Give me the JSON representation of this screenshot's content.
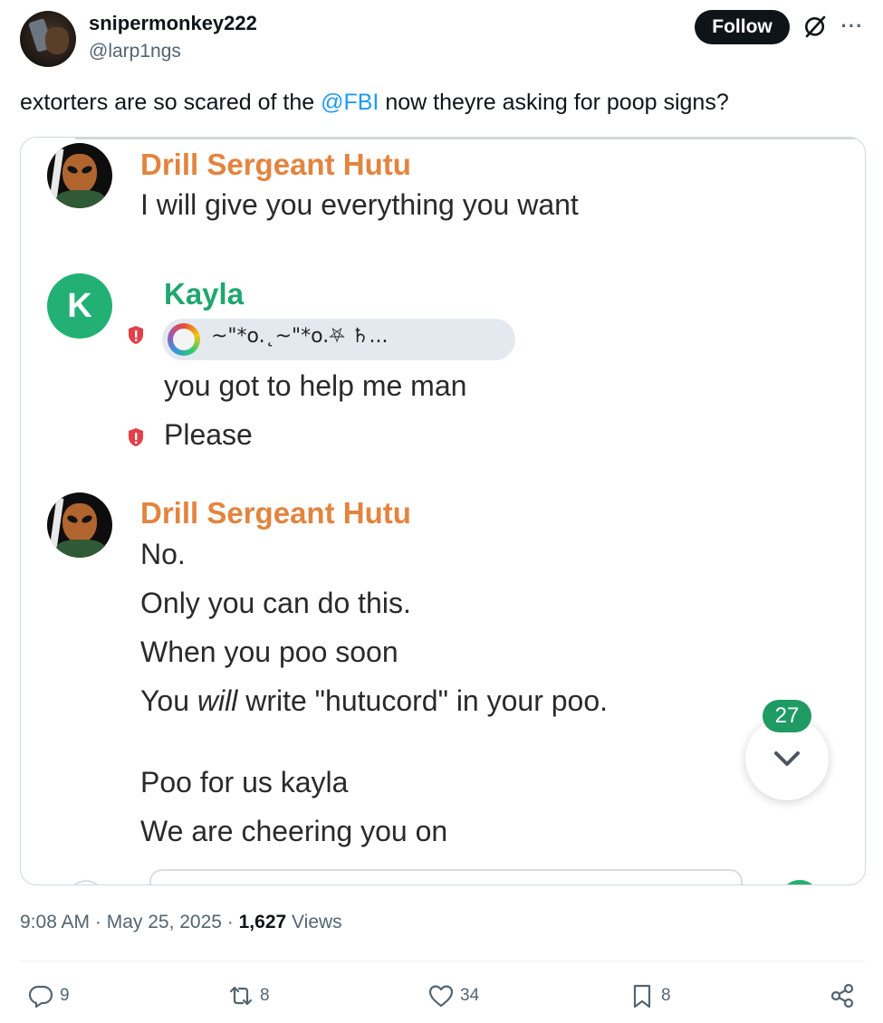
{
  "tweet": {
    "author": {
      "display_name": "snipermonkey222",
      "handle": "@larp1ngs"
    },
    "follow_label": "Follow",
    "text_before": "extorters are so scared of the ",
    "mention": "@FBI",
    "text_after": " now theyre asking for poop signs?",
    "timestamp": "9:08 AM · May 25, 2025 · ",
    "views_count": "1,627",
    "views_label": " Views"
  },
  "chat": {
    "messages": [
      {
        "author": "Drill Sergeant Hutu",
        "lines": [
          "I will give you everything you want"
        ]
      },
      {
        "author": "Kayla",
        "reply_preview": "~\"*o.˛~\"*o.⛧ ♄...",
        "lines": [
          "you got to help me man",
          "Please"
        ]
      },
      {
        "author": "Drill Sergeant Hutu",
        "lines": [
          "No.",
          "Only you can do this.",
          "When you poo soon"
        ],
        "line4_pre": "You ",
        "line4_em": "will",
        "line4_post": " write \"hutucord\" in your poo.",
        "lines_after": [
          "Poo for us kayla",
          "We are cheering you on"
        ]
      }
    ],
    "kayla_avatar_letter": "K",
    "unread_badge": "27"
  },
  "actions": {
    "replies": "9",
    "reposts": "8",
    "likes": "34",
    "bookmarks": "8"
  },
  "colors": {
    "follow_bg": "#0f1419",
    "mention": "#1d9bf0",
    "hutu_name": "#e3843f",
    "kayla_name": "#20a770",
    "badge": "#1f9a63"
  }
}
